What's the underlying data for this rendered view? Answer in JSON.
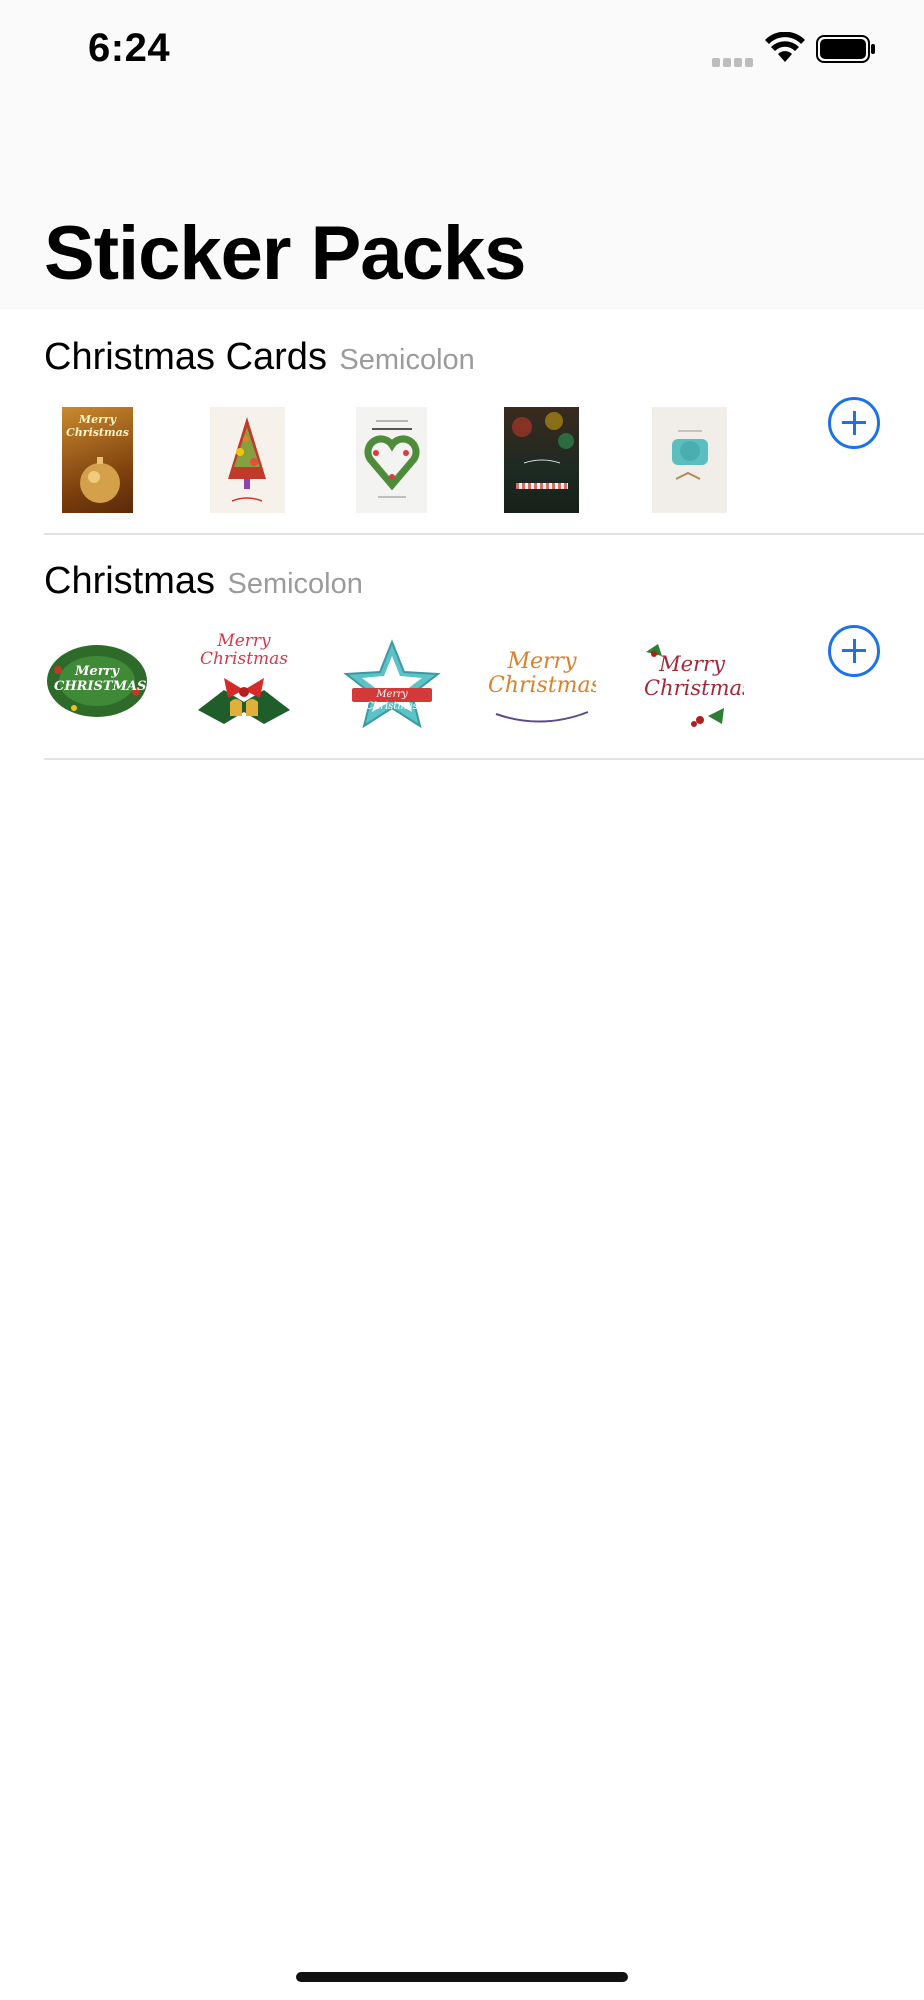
{
  "status_bar": {
    "time": "6:24"
  },
  "page": {
    "title": "Sticker Packs"
  },
  "packs": [
    {
      "name": "Christmas Cards",
      "publisher": "Semicolon",
      "stickers": [
        {
          "name": "gold-ornament-card",
          "text": "Merry Christmas"
        },
        {
          "name": "decorated-tree-card",
          "text": ""
        },
        {
          "name": "heart-wreath-card",
          "text": ""
        },
        {
          "name": "dark-bokeh-card",
          "text": ""
        },
        {
          "name": "teal-label-card",
          "text": ""
        }
      ]
    },
    {
      "name": "Christmas",
      "publisher": "Semicolon",
      "stickers": [
        {
          "name": "wreath-sticker",
          "text": "Merry CHRISTMAS"
        },
        {
          "name": "bells-bow-sticker",
          "text": "Merry Christmas"
        },
        {
          "name": "star-banner-sticker",
          "text": "Merry Christmas"
        },
        {
          "name": "script-lettering-sticker",
          "text": "Merry Christmas"
        },
        {
          "name": "holly-lettering-sticker",
          "text": "Merry Christmas"
        }
      ]
    }
  ],
  "colors": {
    "accent": "#1a73e8",
    "secondary_text": "#9b9b9b",
    "divider": "#e3e3e3"
  },
  "icons": [
    "wifi-icon",
    "battery-icon",
    "signal-icon",
    "add-icon"
  ]
}
